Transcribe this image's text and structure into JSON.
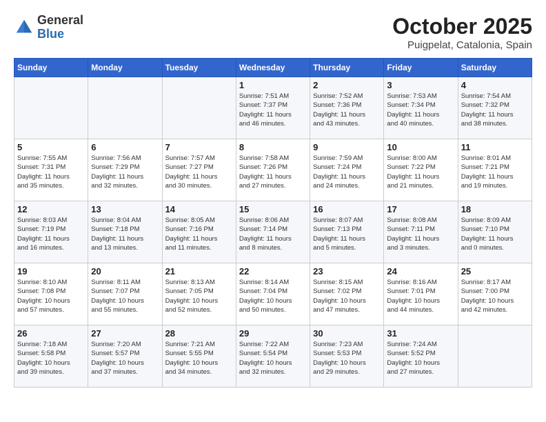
{
  "logo": {
    "general": "General",
    "blue": "Blue"
  },
  "title": "October 2025",
  "subtitle": "Puigpelat, Catalonia, Spain",
  "weekdays": [
    "Sunday",
    "Monday",
    "Tuesday",
    "Wednesday",
    "Thursday",
    "Friday",
    "Saturday"
  ],
  "weeks": [
    [
      {
        "day": "",
        "info": ""
      },
      {
        "day": "",
        "info": ""
      },
      {
        "day": "",
        "info": ""
      },
      {
        "day": "1",
        "info": "Sunrise: 7:51 AM\nSunset: 7:37 PM\nDaylight: 11 hours\nand 46 minutes."
      },
      {
        "day": "2",
        "info": "Sunrise: 7:52 AM\nSunset: 7:36 PM\nDaylight: 11 hours\nand 43 minutes."
      },
      {
        "day": "3",
        "info": "Sunrise: 7:53 AM\nSunset: 7:34 PM\nDaylight: 11 hours\nand 40 minutes."
      },
      {
        "day": "4",
        "info": "Sunrise: 7:54 AM\nSunset: 7:32 PM\nDaylight: 11 hours\nand 38 minutes."
      }
    ],
    [
      {
        "day": "5",
        "info": "Sunrise: 7:55 AM\nSunset: 7:31 PM\nDaylight: 11 hours\nand 35 minutes."
      },
      {
        "day": "6",
        "info": "Sunrise: 7:56 AM\nSunset: 7:29 PM\nDaylight: 11 hours\nand 32 minutes."
      },
      {
        "day": "7",
        "info": "Sunrise: 7:57 AM\nSunset: 7:27 PM\nDaylight: 11 hours\nand 30 minutes."
      },
      {
        "day": "8",
        "info": "Sunrise: 7:58 AM\nSunset: 7:26 PM\nDaylight: 11 hours\nand 27 minutes."
      },
      {
        "day": "9",
        "info": "Sunrise: 7:59 AM\nSunset: 7:24 PM\nDaylight: 11 hours\nand 24 minutes."
      },
      {
        "day": "10",
        "info": "Sunrise: 8:00 AM\nSunset: 7:22 PM\nDaylight: 11 hours\nand 21 minutes."
      },
      {
        "day": "11",
        "info": "Sunrise: 8:01 AM\nSunset: 7:21 PM\nDaylight: 11 hours\nand 19 minutes."
      }
    ],
    [
      {
        "day": "12",
        "info": "Sunrise: 8:03 AM\nSunset: 7:19 PM\nDaylight: 11 hours\nand 16 minutes."
      },
      {
        "day": "13",
        "info": "Sunrise: 8:04 AM\nSunset: 7:18 PM\nDaylight: 11 hours\nand 13 minutes."
      },
      {
        "day": "14",
        "info": "Sunrise: 8:05 AM\nSunset: 7:16 PM\nDaylight: 11 hours\nand 11 minutes."
      },
      {
        "day": "15",
        "info": "Sunrise: 8:06 AM\nSunset: 7:14 PM\nDaylight: 11 hours\nand 8 minutes."
      },
      {
        "day": "16",
        "info": "Sunrise: 8:07 AM\nSunset: 7:13 PM\nDaylight: 11 hours\nand 5 minutes."
      },
      {
        "day": "17",
        "info": "Sunrise: 8:08 AM\nSunset: 7:11 PM\nDaylight: 11 hours\nand 3 minutes."
      },
      {
        "day": "18",
        "info": "Sunrise: 8:09 AM\nSunset: 7:10 PM\nDaylight: 11 hours\nand 0 minutes."
      }
    ],
    [
      {
        "day": "19",
        "info": "Sunrise: 8:10 AM\nSunset: 7:08 PM\nDaylight: 10 hours\nand 57 minutes."
      },
      {
        "day": "20",
        "info": "Sunrise: 8:11 AM\nSunset: 7:07 PM\nDaylight: 10 hours\nand 55 minutes."
      },
      {
        "day": "21",
        "info": "Sunrise: 8:13 AM\nSunset: 7:05 PM\nDaylight: 10 hours\nand 52 minutes."
      },
      {
        "day": "22",
        "info": "Sunrise: 8:14 AM\nSunset: 7:04 PM\nDaylight: 10 hours\nand 50 minutes."
      },
      {
        "day": "23",
        "info": "Sunrise: 8:15 AM\nSunset: 7:02 PM\nDaylight: 10 hours\nand 47 minutes."
      },
      {
        "day": "24",
        "info": "Sunrise: 8:16 AM\nSunset: 7:01 PM\nDaylight: 10 hours\nand 44 minutes."
      },
      {
        "day": "25",
        "info": "Sunrise: 8:17 AM\nSunset: 7:00 PM\nDaylight: 10 hours\nand 42 minutes."
      }
    ],
    [
      {
        "day": "26",
        "info": "Sunrise: 7:18 AM\nSunset: 5:58 PM\nDaylight: 10 hours\nand 39 minutes."
      },
      {
        "day": "27",
        "info": "Sunrise: 7:20 AM\nSunset: 5:57 PM\nDaylight: 10 hours\nand 37 minutes."
      },
      {
        "day": "28",
        "info": "Sunrise: 7:21 AM\nSunset: 5:55 PM\nDaylight: 10 hours\nand 34 minutes."
      },
      {
        "day": "29",
        "info": "Sunrise: 7:22 AM\nSunset: 5:54 PM\nDaylight: 10 hours\nand 32 minutes."
      },
      {
        "day": "30",
        "info": "Sunrise: 7:23 AM\nSunset: 5:53 PM\nDaylight: 10 hours\nand 29 minutes."
      },
      {
        "day": "31",
        "info": "Sunrise: 7:24 AM\nSunset: 5:52 PM\nDaylight: 10 hours\nand 27 minutes."
      },
      {
        "day": "",
        "info": ""
      }
    ]
  ]
}
